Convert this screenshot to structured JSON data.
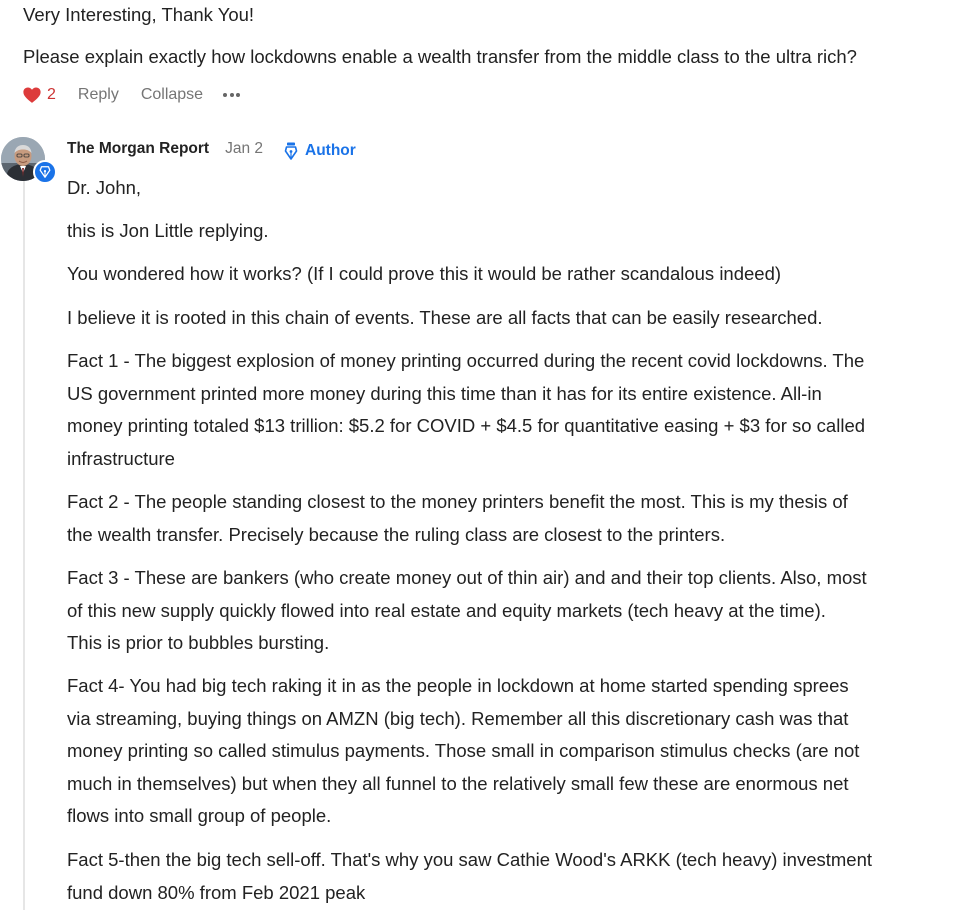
{
  "parent_comment": {
    "title_line": "Very Interesting, Thank You!",
    "question": "Please explain exactly how lockdowns enable a wealth transfer from the middle class to the ultra rich?",
    "like_count": "2",
    "reply_label": "Reply",
    "collapse_label": "Collapse"
  },
  "reply": {
    "author": "The Morgan Report",
    "date": "Jan 2",
    "badge_label": "Author",
    "paragraphs": {
      "p1": "Dr. John,",
      "p2": "this is Jon Little replying.",
      "p3": "You wondered how it works? (If I could prove this it would be rather scandalous indeed)",
      "p4": "I believe it is rooted in this chain of events. These are all facts that can be easily researched.",
      "p5_lines": [
        "Fact 1 - The biggest explosion of money printing occurred during the recent covid lockdowns. The",
        "US government printed more money during this time than it has for its entire existence. All-in",
        "money printing totaled $13 trillion: $5.2 for COVID + $4.5 for quantitative easing + $3 for so called",
        "infrastructure"
      ],
      "p6_lines": [
        "Fact 2 - The people standing closest to the money printers benefit the most. This is my thesis of",
        "the wealth transfer. Precisely because the ruling class are closest to the printers."
      ],
      "p7_lines": [
        "Fact 3 - These are bankers (who create money out of thin air) and and their top clients. Also, most",
        "of this new supply quickly flowed into real estate and equity markets (tech heavy at the time).",
        "This is prior to bubbles bursting."
      ],
      "p8_lines": [
        "Fact 4- You had big tech raking it in as the people in lockdown at home started spending sprees",
        "via streaming, buying things on AMZN (big tech). Remember all this discretionary cash was that",
        "money printing so called stimulus payments. Those small in comparison stimulus checks (are not",
        "much in themselves) but when they all funnel to the relatively small few these are enormous net",
        "flows into small group of people."
      ],
      "p9_lines": [
        "Fact 5-then the big tech sell-off. That's why you saw Cathie Wood's ARKK (tech heavy) investment",
        "fund down 80% from Feb 2021 peak"
      ]
    }
  },
  "colors": {
    "accent": "#1a73e8",
    "like": "#cc3333",
    "muted": "#757575",
    "text": "#222222"
  },
  "icons": {
    "like": "heart-icon",
    "more": "more-dots-icon",
    "author_badge": "fountain-pen-nib-icon",
    "avatar_badge": "fountain-pen-nib-icon"
  }
}
